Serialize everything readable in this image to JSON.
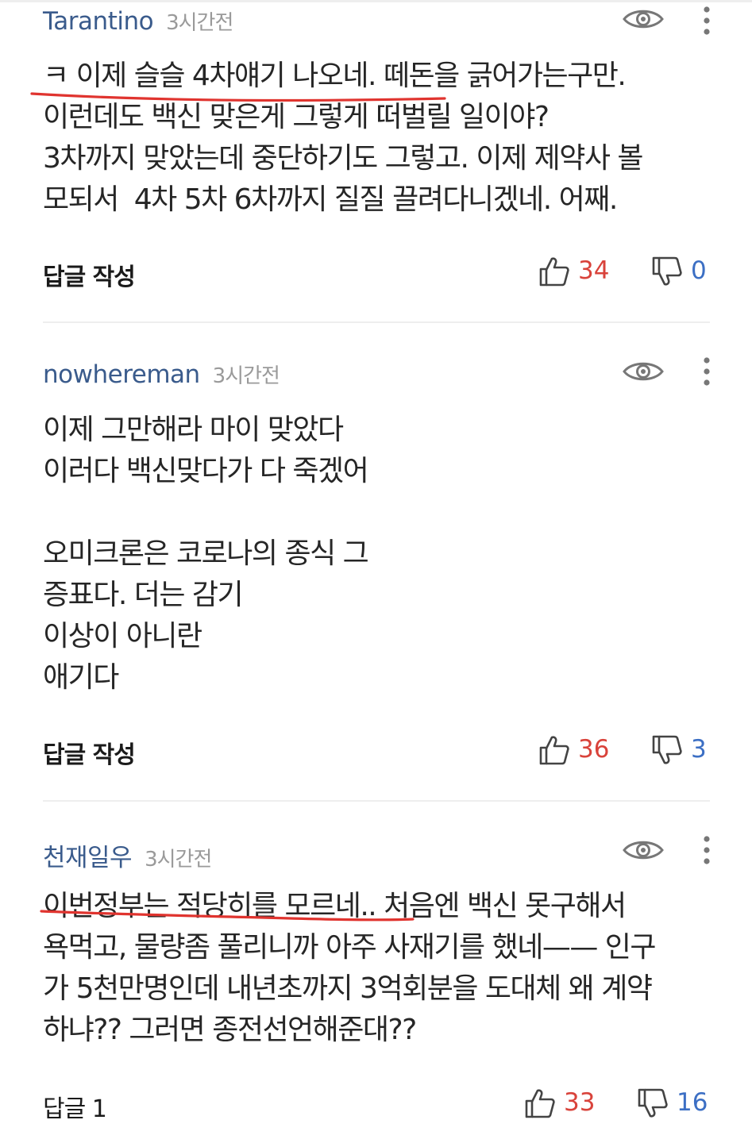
{
  "comments": [
    {
      "author": "Tarantino",
      "time": "3시간전",
      "text": "ㅋ 이제 슬슬 4차얘기 나오네. 떼돈을 긁어가는구만.\n이런데도 백신 맞은게 그렇게 떠벌릴 일이야?\n3차까지 맞았는데 중단하기도 그렇고. 이제 제약사 볼\n모되서  4차 5차 6차까지 질질 끌려다니겠네. 어째.",
      "reply_label": "답글 작성",
      "likes": "34",
      "dislikes": "0"
    },
    {
      "author": "nowhereman",
      "time": "3시간전",
      "text": "이제 그만해라 마이 맞았다\n이러다 백신맞다가 다 죽겠어\n\n오미크론은 코로나의 종식 그\n증표다. 더는 감기\n이상이 아니란\n애기다",
      "reply_label": "답글 작성",
      "likes": "36",
      "dislikes": "3"
    },
    {
      "author": "천재일우",
      "time": "3시간전",
      "text": "이번정부는 적당히를 모르네.. 처음엔 백신 못구해서\n욕먹고, 물량좀 풀리니까 아주 사재기를 했네—— 인구\n가 5천만명인데 내년초까지 3억회분을 도대체 왜 계약\n하냐?? 그러면 종전선언해준대??",
      "reply_label": "답글 1",
      "likes": "33",
      "dislikes": "16"
    }
  ],
  "colors": {
    "author": "#3a5b8c",
    "like": "#d9433b",
    "dislike": "#3c6fc4",
    "underline": "#e0342f"
  },
  "icons": {
    "view": "eye-icon",
    "menu": "more-vertical-icon",
    "like": "thumbs-up-icon",
    "dislike": "thumbs-down-icon"
  }
}
